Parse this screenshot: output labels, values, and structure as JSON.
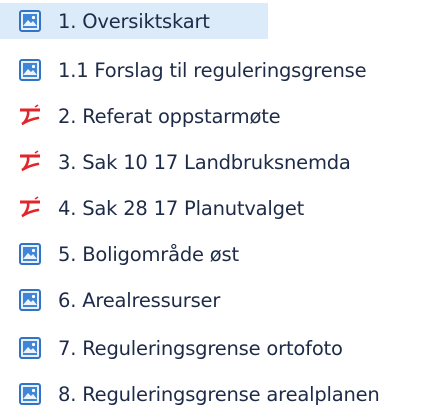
{
  "files": [
    {
      "label": "1. Oversiktskart",
      "icon": "image-file-icon",
      "selected": true
    },
    {
      "label": "1.1 Forslag til reguleringsgrense",
      "icon": "image-file-icon",
      "selected": false
    },
    {
      "label": "2. Referat oppstarmøte",
      "icon": "pdf-file-icon",
      "selected": false
    },
    {
      "label": "3. Sak 10 17 Landbruksnemda",
      "icon": "pdf-file-icon",
      "selected": false
    },
    {
      "label": "4. Sak 28 17 Planutvalget",
      "icon": "pdf-file-icon",
      "selected": false
    },
    {
      "label": "5. Boligområde øst",
      "icon": "image-file-icon",
      "selected": false
    },
    {
      "label": "6. Arealressurser",
      "icon": "image-file-icon",
      "selected": false
    },
    {
      "label": "7. Reguleringsgrense ortofoto",
      "icon": "image-file-icon",
      "selected": false
    },
    {
      "label": "8. Reguleringsgrense arealplanen",
      "icon": "image-file-icon",
      "selected": false
    }
  ],
  "colors": {
    "selection": "#dcebf9",
    "text": "#1e2b48",
    "pdf_red": "#e0252b",
    "image_blue": "#2f74c9"
  }
}
